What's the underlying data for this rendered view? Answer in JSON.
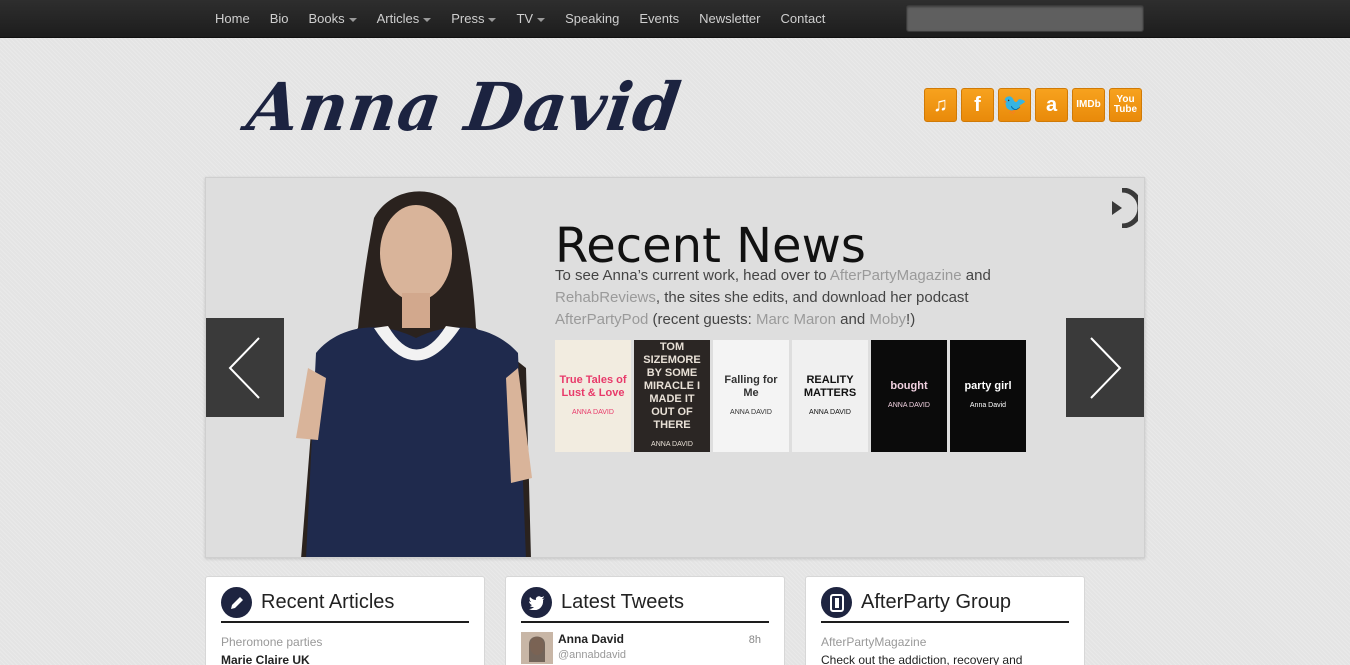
{
  "nav": {
    "items": [
      {
        "label": "Home",
        "dropdown": false
      },
      {
        "label": "Bio",
        "dropdown": false
      },
      {
        "label": "Books",
        "dropdown": true
      },
      {
        "label": "Articles",
        "dropdown": true
      },
      {
        "label": "Press",
        "dropdown": true
      },
      {
        "label": "TV",
        "dropdown": true
      },
      {
        "label": "Speaking",
        "dropdown": false
      },
      {
        "label": "Events",
        "dropdown": false
      },
      {
        "label": "Newsletter",
        "dropdown": false
      },
      {
        "label": "Contact",
        "dropdown": false
      }
    ],
    "search_value": ""
  },
  "header": {
    "logo_text": "Anna David",
    "social": [
      {
        "name": "music-icon",
        "glyph": "♫"
      },
      {
        "name": "facebook-icon",
        "glyph": "f"
      },
      {
        "name": "twitter-icon",
        "glyph": "🐦"
      },
      {
        "name": "amazon-icon",
        "glyph": "a"
      },
      {
        "name": "imdb-icon",
        "glyph": "IMDb"
      },
      {
        "name": "youtube-icon",
        "glyph": "You Tube"
      }
    ],
    "accent_color": "#f29416"
  },
  "slider": {
    "title": "Recent News",
    "text_1": "To see Anna’s current work, head over to ",
    "link_1": "AfterPartyMagazine",
    "text_2": " and ",
    "link_2": "RehabReviews",
    "text_3": ", the sites she edits, and download her podcast ",
    "link_3": "AfterPartyPod",
    "text_4": " (recent guests: ",
    "link_4": "Marc Maron",
    "text_5": " and ",
    "link_5": "Moby",
    "text_6": "!)",
    "books": [
      {
        "name": "book-true-tales",
        "title": "True Tales of Lust & Love",
        "author": "ANNA DAVID",
        "bg": "#f2ece0",
        "fg": "#e83a6a"
      },
      {
        "name": "book-by-some-miracle",
        "title": "TOM SIZEMORE BY SOME MIRACLE I MADE IT OUT OF THERE",
        "author": "ANNA DAVID",
        "bg": "#2b2624",
        "fg": "#e8e0d6"
      },
      {
        "name": "book-falling-for-me",
        "title": "Falling for Me",
        "author": "ANNA DAVID",
        "bg": "#f4f4f4",
        "fg": "#333333"
      },
      {
        "name": "book-reality-matters",
        "title": "REALITY MATTERS",
        "author": "ANNA DAVID",
        "bg": "#f0f0f0",
        "fg": "#111111"
      },
      {
        "name": "book-bought",
        "title": "bought",
        "author": "ANNA DAVID",
        "bg": "#0b0b0b",
        "fg": "#f1d1e0"
      },
      {
        "name": "book-party-girl",
        "title": "party girl",
        "author": "Anna David",
        "bg": "#0a0a0a",
        "fg": "#ffffff"
      }
    ]
  },
  "panels": {
    "articles": {
      "title": "Recent Articles",
      "sub": "Pheromone parties",
      "line": "Marie Claire UK"
    },
    "tweets": {
      "title": "Latest Tweets",
      "name": "Anna David",
      "handle": "@annabdavid",
      "time": "8h"
    },
    "afterparty": {
      "title": "AfterParty Group",
      "sub": "AfterPartyMagazine",
      "line": "Check out the addiction, recovery and relationship"
    }
  }
}
